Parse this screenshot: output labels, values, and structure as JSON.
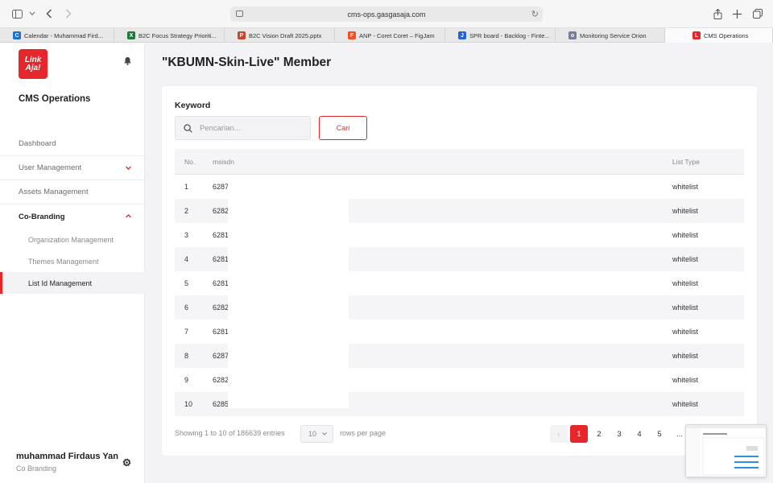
{
  "browser": {
    "url": "cms-ops.gasgasaja.com",
    "tabs": [
      {
        "label": "Calendar - Muhammad Fird...",
        "color": "#1f6fd1",
        "glyph": "C",
        "width": 142
      },
      {
        "label": "B2C Focus Strategy Prioriti...",
        "color": "#1d7a3d",
        "glyph": "X",
        "width": 137
      },
      {
        "label": "B2C Vision Draft 2025.pptx",
        "color": "#c8462d",
        "glyph": "P",
        "width": 137
      },
      {
        "label": "ANP - Coret Coret – FigJam",
        "color": "#f24e1e",
        "glyph": "F",
        "width": 137
      },
      {
        "label": "SPR board - Backlog - Finte...",
        "color": "#2460d9",
        "glyph": "J",
        "width": 137
      },
      {
        "label": "Monitoring Service Orion",
        "color": "#7a7a9a",
        "glyph": "o",
        "width": 136
      },
      {
        "label": "CMS Operations",
        "color": "#e5262b",
        "glyph": "L",
        "width": 134,
        "active": true
      }
    ]
  },
  "sidebar": {
    "logo": "LinkAja!",
    "logo_line1": "Link",
    "logo_line2": "Aja!",
    "app_name": "CMS Operations",
    "items": [
      {
        "label": "Dashboard"
      },
      {
        "label": "User Management"
      },
      {
        "label": "Assets Management"
      },
      {
        "label": "Co-Branding"
      }
    ],
    "sub_items": [
      {
        "label": "Organization Management"
      },
      {
        "label": "Themes Management"
      },
      {
        "label": "List Id Management"
      }
    ],
    "user_name": "muhammad Firdaus Yan",
    "user_role": "Co Branding"
  },
  "page": {
    "title": "\"KBUMN-Skin-Live\" Member",
    "keyword_label": "Keyword",
    "search_placeholder": "Pencarian...",
    "search_button": "Cari"
  },
  "table": {
    "headers": {
      "no": "No.",
      "msisdn": "msisdn",
      "list_type": "List Type"
    },
    "rows": [
      {
        "no": "1",
        "msisdn": "6287",
        "type": "whitelist"
      },
      {
        "no": "2",
        "msisdn": "6282",
        "type": "whitelist"
      },
      {
        "no": "3",
        "msisdn": "6281",
        "type": "whitelist"
      },
      {
        "no": "4",
        "msisdn": "6281",
        "type": "whitelist"
      },
      {
        "no": "5",
        "msisdn": "6281",
        "type": "whitelist"
      },
      {
        "no": "6",
        "msisdn": "6282",
        "type": "whitelist"
      },
      {
        "no": "7",
        "msisdn": "6281",
        "type": "whitelist"
      },
      {
        "no": "8",
        "msisdn": "6287",
        "type": "whitelist"
      },
      {
        "no": "9",
        "msisdn": "6282",
        "type": "whitelist"
      },
      {
        "no": "10",
        "msisdn": "6285",
        "type": "whitelist"
      }
    ]
  },
  "footer": {
    "showing": "Showing 1 to 10 of 186639 entries",
    "rows_per_page_value": "10",
    "rows_per_page_label": "rows per page",
    "prev": "‹",
    "pages": [
      "1",
      "2",
      "3",
      "4",
      "5"
    ],
    "active_page": "1",
    "ellipsis": "..."
  },
  "colors": {
    "accent": "#e5262b"
  }
}
